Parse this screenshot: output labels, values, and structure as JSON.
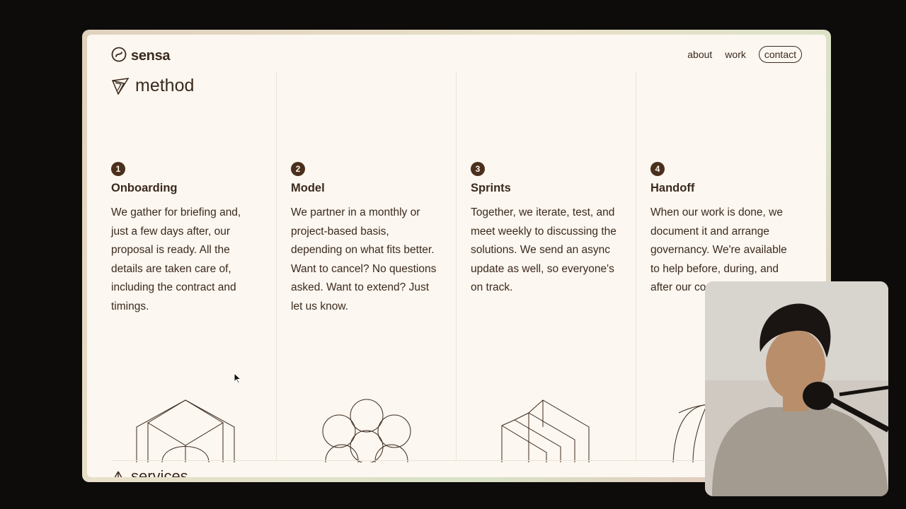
{
  "site": {
    "brand": "sensa",
    "nav": {
      "about": "about",
      "work": "work",
      "contact": "contact"
    },
    "section_title": "method",
    "next_section": "services"
  },
  "steps": [
    {
      "number": "1",
      "title": "Onboarding",
      "text": "We gather for briefing and, just a few days after, our proposal is ready. All the details are taken care of, including the contract and timings."
    },
    {
      "number": "2",
      "title": "Model",
      "text": "We partner in a monthly or project-based basis, depending on what fits better. Want to cancel? No questions asked. Want to extend? Just let us know."
    },
    {
      "number": "3",
      "title": "Sprints",
      "text": "Together, we iterate, test, and meet weekly to discussing the solutions. We send an async update as well, so everyone's on track."
    },
    {
      "number": "4",
      "title": "Handoff",
      "text": "When our work is done, we document it and arrange governancy. We're available to help before, during, and after our co"
    }
  ],
  "colors": {
    "ink": "#3b2a1e",
    "badge": "#4a2f1c",
    "paper": "#fcf7f0",
    "desktop": "#0d0c0b"
  },
  "icons": {
    "logo": "sensa-logo-icon",
    "method": "method-prism-icon",
    "services": "services-arrow-icon"
  }
}
